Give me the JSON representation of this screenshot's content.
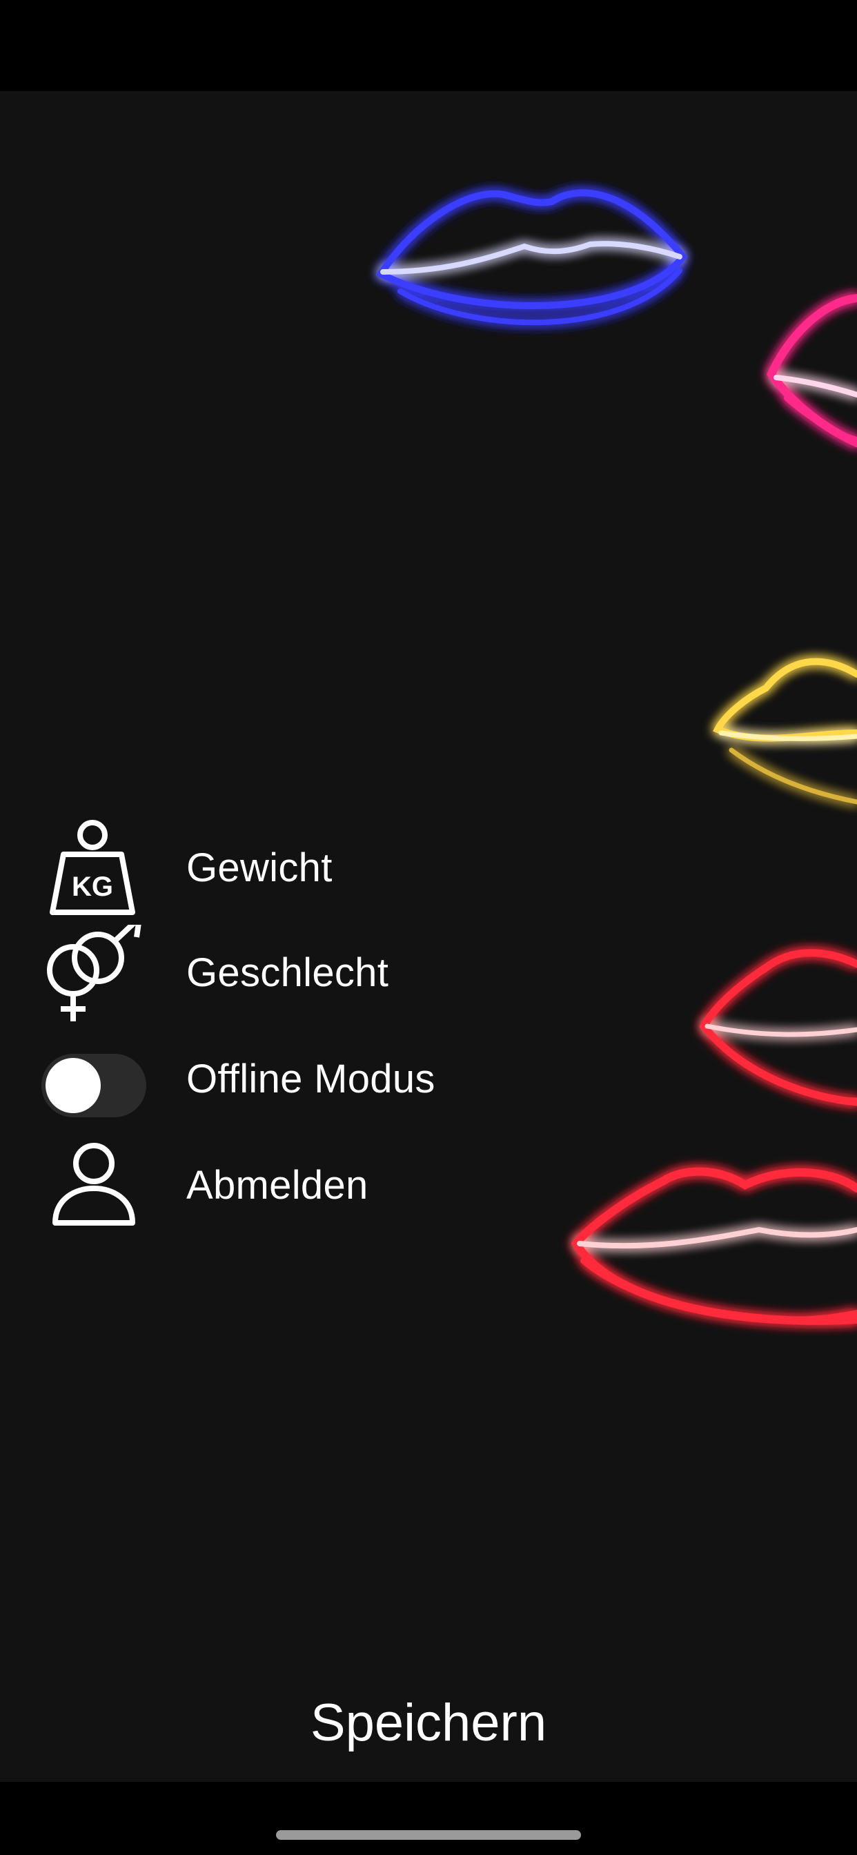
{
  "menu": {
    "items": [
      {
        "label": "Gewicht",
        "icon": "weight-kg-icon",
        "icon_text": "KG"
      },
      {
        "label": "Geschlecht",
        "icon": "gender-icon"
      },
      {
        "label": "Offline Modus",
        "control": "toggle",
        "toggle_on": false
      },
      {
        "label": "Abmelden",
        "icon": "user-icon"
      }
    ]
  },
  "save_label": "Speichern",
  "background": {
    "description_icon": "neon-lips-icon",
    "colors": {
      "blue": "#3a3cff",
      "pink": "#ff2a8a",
      "yellow": "#ffd84a",
      "red": "#ff2a3a"
    }
  },
  "colors": {
    "page_bg": "#121212",
    "bars": "#000000",
    "text": "#ffffff"
  }
}
